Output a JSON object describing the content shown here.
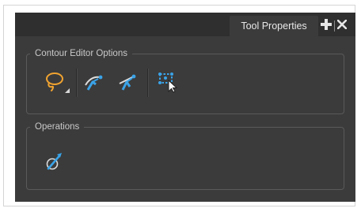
{
  "panel": {
    "tab_label": "Tool Properties",
    "add_icon": "plus-icon",
    "close_icon": "close-icon"
  },
  "contour_editor_options": {
    "title": "Contour Editor Options",
    "tools": [
      {
        "name": "lasso-icon",
        "has_menu": true
      },
      {
        "name": "tangent-smooth-icon"
      },
      {
        "name": "tangent-corner-icon"
      },
      {
        "name": "select-points-icon"
      }
    ]
  },
  "operations": {
    "title": "Operations",
    "tools": [
      {
        "name": "pencil-to-brush-icon"
      }
    ]
  },
  "colors": {
    "panel_bg": "#3b3b3b",
    "tab_bar": "#2f2f2f",
    "accent_orange": "#f0a330",
    "accent_blue": "#3aa3e8"
  }
}
